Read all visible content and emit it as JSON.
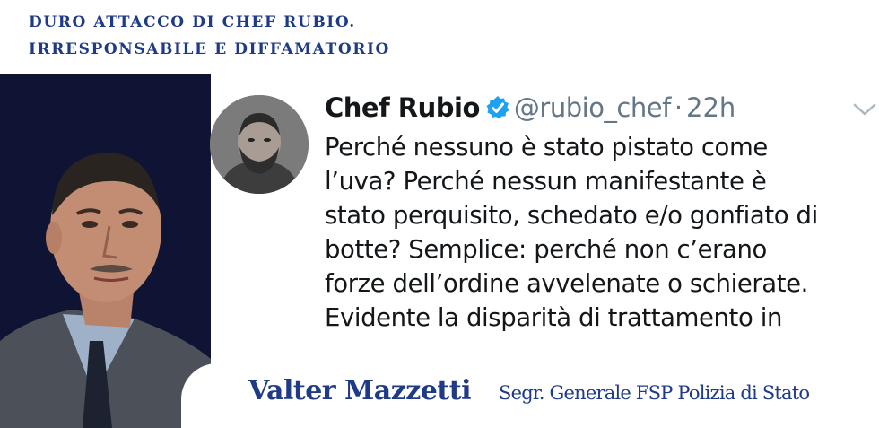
{
  "headline": {
    "line1": "DURO ATTACCO DI CHEF RUBIO.",
    "line2": "IRRESPONSABILE E DIFFAMATORIO"
  },
  "tweet": {
    "author_name": "Chef Rubio",
    "handle": "@rubio_chef",
    "separator": "·",
    "time": "22h",
    "verified_icon": "verified-badge-icon",
    "menu_icon": "chevron-down-icon",
    "body_lines": [
      "Perché nessuno è stato pistato come",
      "l’uva? Perché nessun manifestante è",
      "stato perquisito, schedato e/o gonfiato di",
      "botte? Semplice: perché non c’erano",
      "forze dell’ordine avvelenate o schierate.",
      "Evidente la disparità di trattamento in"
    ]
  },
  "caption": {
    "name": "Valter Mazzetti",
    "role": "Segr. Generale FSP Polizia di Stato"
  },
  "colors": {
    "brand_blue": "#1f3a86",
    "navy_panel": "#0f1434",
    "twitter_blue": "#1da1f2",
    "muted_gray": "#657786"
  }
}
